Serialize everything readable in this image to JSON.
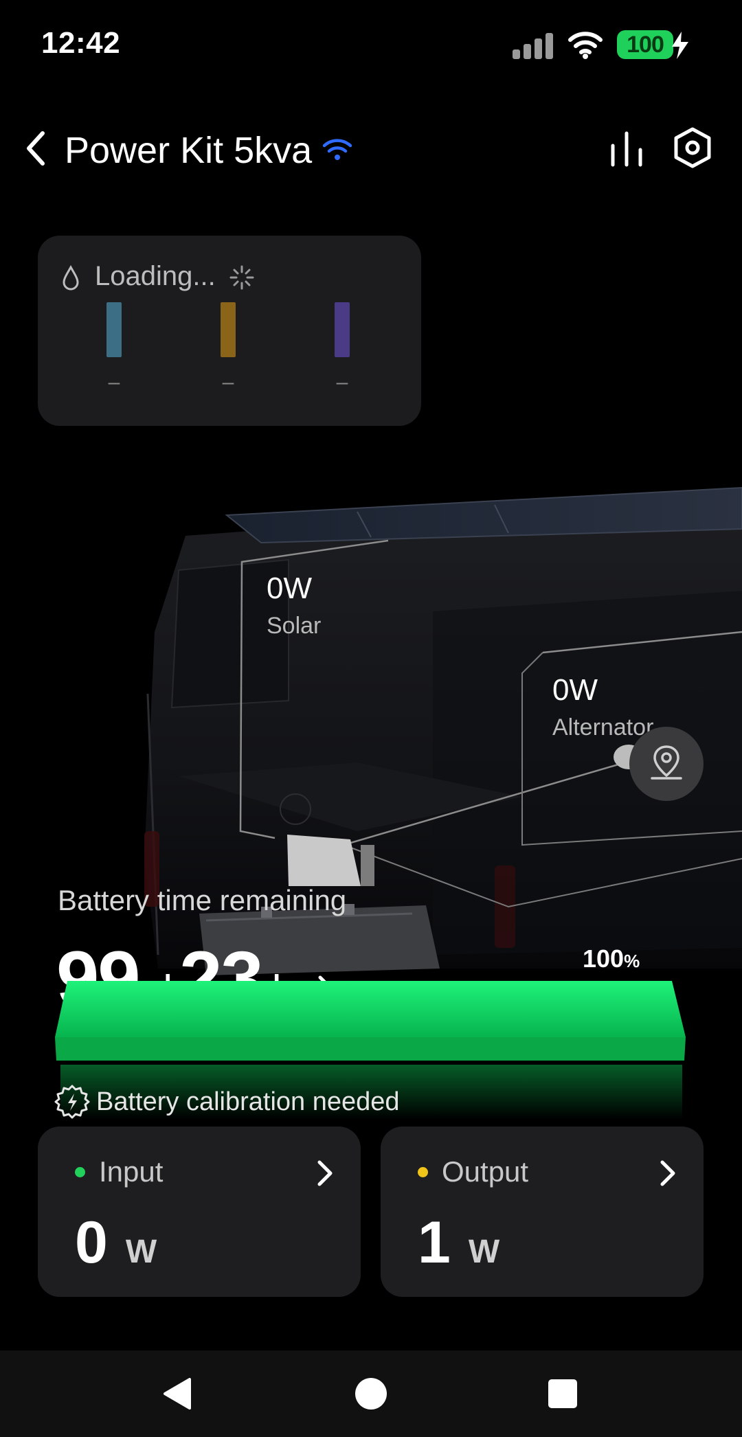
{
  "status_bar": {
    "time": "12:42",
    "battery": "100"
  },
  "header": {
    "title": "Power Kit 5kva"
  },
  "tank_card": {
    "loading_text": "Loading...",
    "levels": [
      {
        "label": "–",
        "color": "#3c6e86"
      },
      {
        "label": "–",
        "color": "#8a6418"
      },
      {
        "label": "–",
        "color": "#4b3a86"
      }
    ]
  },
  "sources": {
    "solar": {
      "value": "0W",
      "label": "Solar"
    },
    "alternator": {
      "value": "0W",
      "label": "Alternator"
    }
  },
  "battery": {
    "label": "Battery time remaining",
    "days": "99",
    "days_unit": "d",
    "hours": "23",
    "hours_unit": "h",
    "percent": "100",
    "percent_sign": "%",
    "level_fraction": 1.0
  },
  "calibration": {
    "text": "Battery calibration needed"
  },
  "input": {
    "label": "Input",
    "value": "0",
    "unit": "W",
    "dot_color": "#22d05c"
  },
  "output": {
    "label": "Output",
    "value": "1",
    "unit": "W",
    "dot_color": "#f0c419"
  }
}
